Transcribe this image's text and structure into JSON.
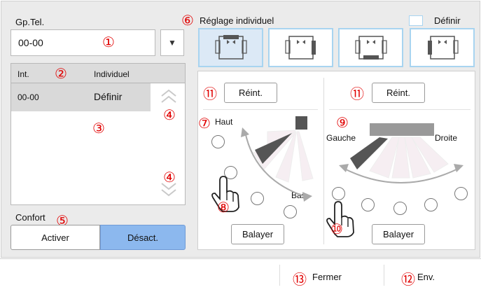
{
  "group": {
    "title": "Gp.Tel.",
    "value": "00-00",
    "dropdown_icon": "triangle-down-icon"
  },
  "table": {
    "col_int": "Int.",
    "col_indiv": "Individuel",
    "rows": [
      {
        "int": "00-00",
        "indiv": "Définir"
      }
    ],
    "scroll_up_icon": "chevron-up-icon",
    "scroll_down_icon": "chevron-down-icon"
  },
  "confort": {
    "title": "Confort",
    "on_label": "Activer",
    "off_label": "Désact.",
    "selected": "Désact."
  },
  "individual": {
    "title": "Réglage individuel",
    "define_label": "Définir",
    "define_checked": false,
    "positions": [
      "position-1",
      "position-2",
      "position-3",
      "position-4"
    ],
    "selected_position": 1
  },
  "vertical": {
    "reset_label": "Réint.",
    "top_label": "Haut",
    "bottom_label": "Bas",
    "swing_label": "Balayer"
  },
  "horizontal": {
    "reset_label": "Réint.",
    "left_label": "Gauche",
    "right_label": "Droite",
    "swing_label": "Balayer"
  },
  "footer": {
    "close_label": "Fermer",
    "send_label": "Env."
  },
  "callouts": [
    "①",
    "②",
    "③",
    "④",
    "⑤",
    "⑥",
    "⑦",
    "⑧",
    "⑨",
    "⑩",
    "⑪",
    "⑫",
    "⑬"
  ],
  "colors": {
    "highlight_blue": "#8cb8ee",
    "selected_row": "#d9d9d9",
    "callout_red": "#e10000",
    "position_border": "#a8d4f0"
  }
}
